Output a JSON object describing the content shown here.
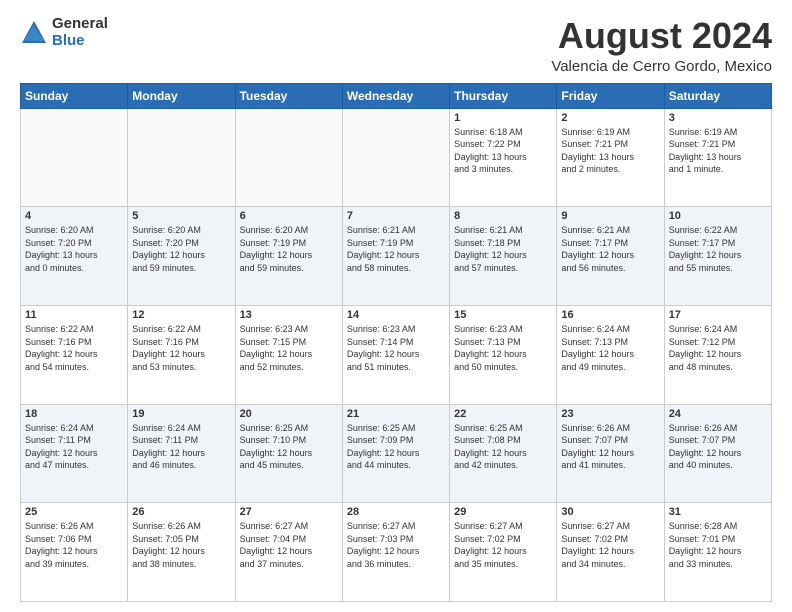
{
  "logo": {
    "general": "General",
    "blue": "Blue"
  },
  "header": {
    "month": "August 2024",
    "location": "Valencia de Cerro Gordo, Mexico"
  },
  "weekdays": [
    "Sunday",
    "Monday",
    "Tuesday",
    "Wednesday",
    "Thursday",
    "Friday",
    "Saturday"
  ],
  "weeks": [
    [
      {
        "day": "",
        "info": ""
      },
      {
        "day": "",
        "info": ""
      },
      {
        "day": "",
        "info": ""
      },
      {
        "day": "",
        "info": ""
      },
      {
        "day": "1",
        "info": "Sunrise: 6:18 AM\nSunset: 7:22 PM\nDaylight: 13 hours\nand 3 minutes."
      },
      {
        "day": "2",
        "info": "Sunrise: 6:19 AM\nSunset: 7:21 PM\nDaylight: 13 hours\nand 2 minutes."
      },
      {
        "day": "3",
        "info": "Sunrise: 6:19 AM\nSunset: 7:21 PM\nDaylight: 13 hours\nand 1 minute."
      }
    ],
    [
      {
        "day": "4",
        "info": "Sunrise: 6:20 AM\nSunset: 7:20 PM\nDaylight: 13 hours\nand 0 minutes."
      },
      {
        "day": "5",
        "info": "Sunrise: 6:20 AM\nSunset: 7:20 PM\nDaylight: 12 hours\nand 59 minutes."
      },
      {
        "day": "6",
        "info": "Sunrise: 6:20 AM\nSunset: 7:19 PM\nDaylight: 12 hours\nand 59 minutes."
      },
      {
        "day": "7",
        "info": "Sunrise: 6:21 AM\nSunset: 7:19 PM\nDaylight: 12 hours\nand 58 minutes."
      },
      {
        "day": "8",
        "info": "Sunrise: 6:21 AM\nSunset: 7:18 PM\nDaylight: 12 hours\nand 57 minutes."
      },
      {
        "day": "9",
        "info": "Sunrise: 6:21 AM\nSunset: 7:17 PM\nDaylight: 12 hours\nand 56 minutes."
      },
      {
        "day": "10",
        "info": "Sunrise: 6:22 AM\nSunset: 7:17 PM\nDaylight: 12 hours\nand 55 minutes."
      }
    ],
    [
      {
        "day": "11",
        "info": "Sunrise: 6:22 AM\nSunset: 7:16 PM\nDaylight: 12 hours\nand 54 minutes."
      },
      {
        "day": "12",
        "info": "Sunrise: 6:22 AM\nSunset: 7:16 PM\nDaylight: 12 hours\nand 53 minutes."
      },
      {
        "day": "13",
        "info": "Sunrise: 6:23 AM\nSunset: 7:15 PM\nDaylight: 12 hours\nand 52 minutes."
      },
      {
        "day": "14",
        "info": "Sunrise: 6:23 AM\nSunset: 7:14 PM\nDaylight: 12 hours\nand 51 minutes."
      },
      {
        "day": "15",
        "info": "Sunrise: 6:23 AM\nSunset: 7:13 PM\nDaylight: 12 hours\nand 50 minutes."
      },
      {
        "day": "16",
        "info": "Sunrise: 6:24 AM\nSunset: 7:13 PM\nDaylight: 12 hours\nand 49 minutes."
      },
      {
        "day": "17",
        "info": "Sunrise: 6:24 AM\nSunset: 7:12 PM\nDaylight: 12 hours\nand 48 minutes."
      }
    ],
    [
      {
        "day": "18",
        "info": "Sunrise: 6:24 AM\nSunset: 7:11 PM\nDaylight: 12 hours\nand 47 minutes."
      },
      {
        "day": "19",
        "info": "Sunrise: 6:24 AM\nSunset: 7:11 PM\nDaylight: 12 hours\nand 46 minutes."
      },
      {
        "day": "20",
        "info": "Sunrise: 6:25 AM\nSunset: 7:10 PM\nDaylight: 12 hours\nand 45 minutes."
      },
      {
        "day": "21",
        "info": "Sunrise: 6:25 AM\nSunset: 7:09 PM\nDaylight: 12 hours\nand 44 minutes."
      },
      {
        "day": "22",
        "info": "Sunrise: 6:25 AM\nSunset: 7:08 PM\nDaylight: 12 hours\nand 42 minutes."
      },
      {
        "day": "23",
        "info": "Sunrise: 6:26 AM\nSunset: 7:07 PM\nDaylight: 12 hours\nand 41 minutes."
      },
      {
        "day": "24",
        "info": "Sunrise: 6:26 AM\nSunset: 7:07 PM\nDaylight: 12 hours\nand 40 minutes."
      }
    ],
    [
      {
        "day": "25",
        "info": "Sunrise: 6:26 AM\nSunset: 7:06 PM\nDaylight: 12 hours\nand 39 minutes."
      },
      {
        "day": "26",
        "info": "Sunrise: 6:26 AM\nSunset: 7:05 PM\nDaylight: 12 hours\nand 38 minutes."
      },
      {
        "day": "27",
        "info": "Sunrise: 6:27 AM\nSunset: 7:04 PM\nDaylight: 12 hours\nand 37 minutes."
      },
      {
        "day": "28",
        "info": "Sunrise: 6:27 AM\nSunset: 7:03 PM\nDaylight: 12 hours\nand 36 minutes."
      },
      {
        "day": "29",
        "info": "Sunrise: 6:27 AM\nSunset: 7:02 PM\nDaylight: 12 hours\nand 35 minutes."
      },
      {
        "day": "30",
        "info": "Sunrise: 6:27 AM\nSunset: 7:02 PM\nDaylight: 12 hours\nand 34 minutes."
      },
      {
        "day": "31",
        "info": "Sunrise: 6:28 AM\nSunset: 7:01 PM\nDaylight: 12 hours\nand 33 minutes."
      }
    ]
  ]
}
